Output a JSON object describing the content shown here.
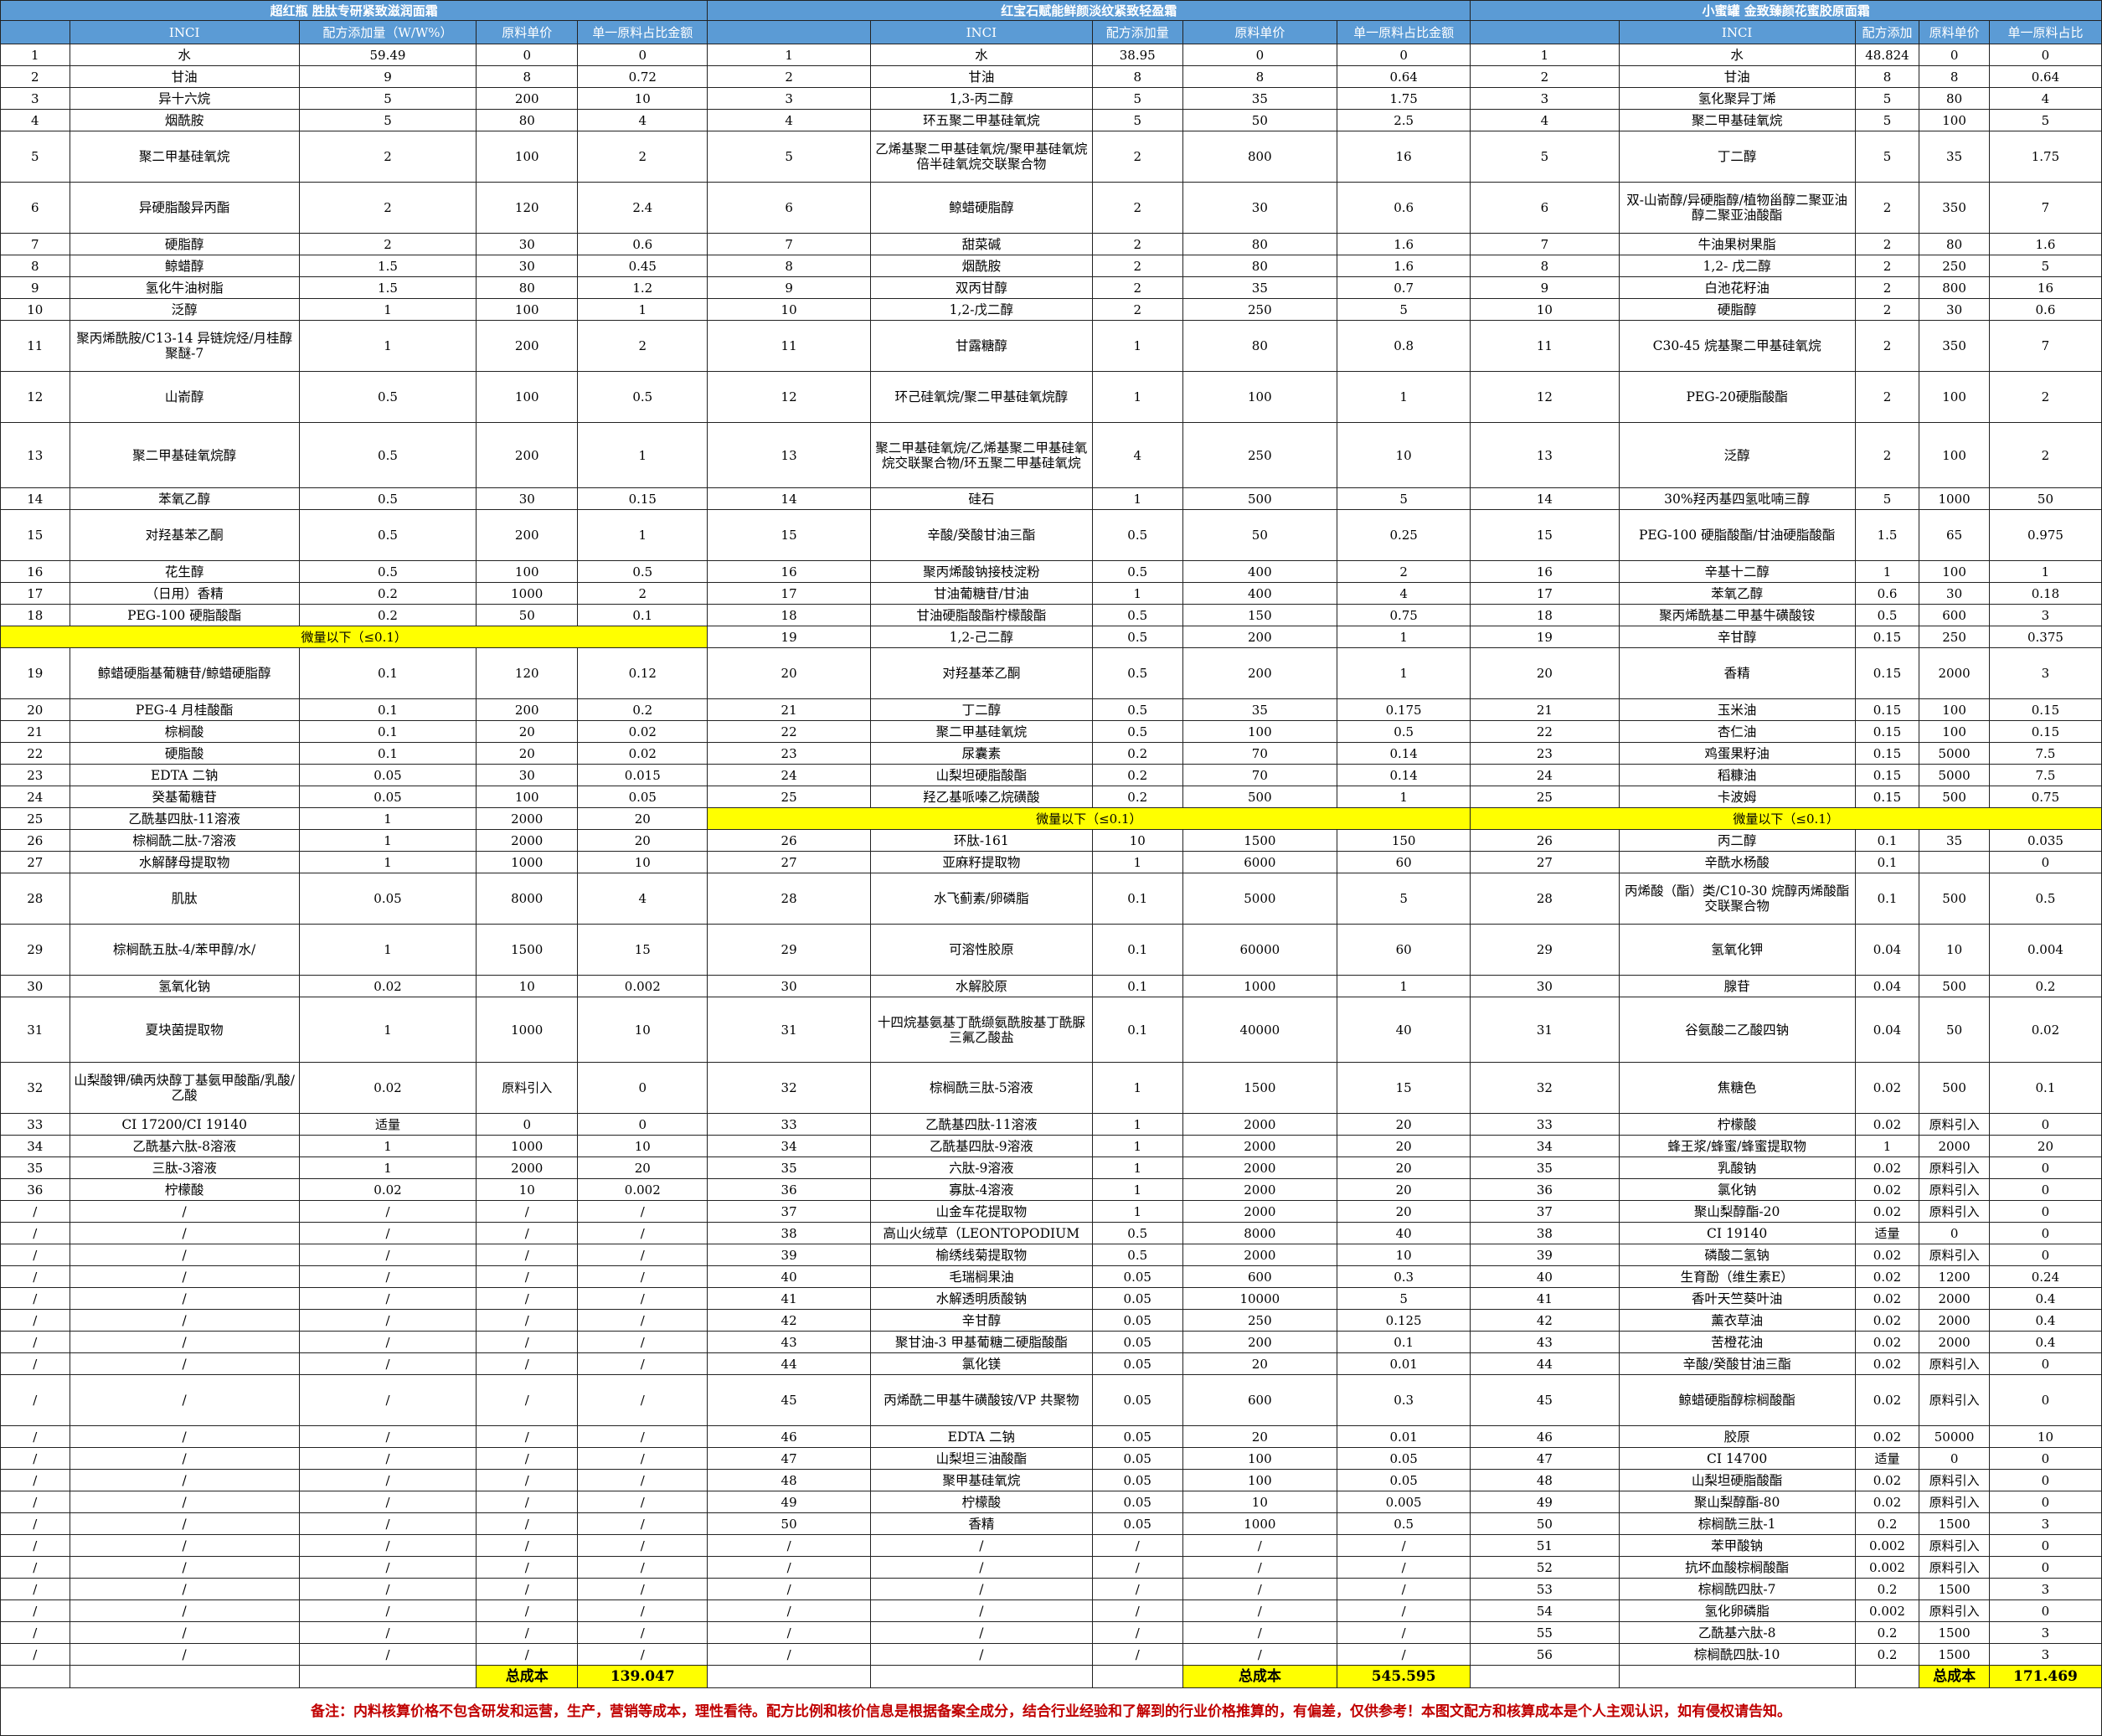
{
  "products": [
    {
      "title": "超红瓶 胜肽专研紧致滋润面霜"
    },
    {
      "title": "红宝石赋能鲜颜淡纹紧致轻盈霜"
    },
    {
      "title": "小蜜罐 金致臻颜花蜜胶原面霜"
    }
  ],
  "headers": [
    [
      "INCI",
      "配方添加量（W/W%）",
      "原料单价",
      "单一原料占比金额"
    ],
    [
      "INCI",
      "配方添加量",
      "原料单价",
      "单一原料占比金额"
    ],
    [
      "INCI",
      "配方添加",
      "原料单价",
      "单一原料占比"
    ]
  ],
  "trace_label": "微量以下（≤0.1）",
  "total_label": "总成本",
  "totals": [
    "139.047",
    "545.595",
    "171.469"
  ],
  "note": "备注：内料核算价格不包含研发和运营，生产，营销等成本，理性看待。配方比例和核价信息是根据备案全成分，结合行业经验和了解到的行业价格推算的，有偏差，仅供参考！本图文配方和核算成本是个人主观认识，如有侵权请告知。",
  "rows": [
    {
      "h": 1,
      "a": [
        "1",
        "水",
        "59.49",
        "0",
        "0"
      ],
      "b": [
        "1",
        "水",
        "38.95",
        "0",
        "0"
      ],
      "c": [
        "1",
        "水",
        "48.824",
        "0",
        "0"
      ]
    },
    {
      "h": 1,
      "a": [
        "2",
        "甘油",
        "9",
        "8",
        "0.72"
      ],
      "b": [
        "2",
        "甘油",
        "8",
        "8",
        "0.64"
      ],
      "c": [
        "2",
        "甘油",
        "8",
        "8",
        "0.64"
      ]
    },
    {
      "h": 1,
      "a": [
        "3",
        "异十六烷",
        "5",
        "200",
        "10"
      ],
      "b": [
        "3",
        "1,3-丙二醇",
        "5",
        "35",
        "1.75"
      ],
      "c": [
        "3",
        "氢化聚异丁烯",
        "5",
        "80",
        "4"
      ]
    },
    {
      "h": 1,
      "a": [
        "4",
        "烟酰胺",
        "5",
        "80",
        "4"
      ],
      "b": [
        "4",
        "环五聚二甲基硅氧烷",
        "5",
        "50",
        "2.5"
      ],
      "c": [
        "4",
        "聚二甲基硅氧烷",
        "5",
        "100",
        "5"
      ]
    },
    {
      "h": 2,
      "a": [
        "5",
        "聚二甲基硅氧烷",
        "2",
        "100",
        "2"
      ],
      "b": [
        "5",
        "乙烯基聚二甲基硅氧烷/聚甲基硅氧烷倍半硅氧烷交联聚合物",
        "2",
        "800",
        "16"
      ],
      "c": [
        "5",
        "丁二醇",
        "5",
        "35",
        "1.75"
      ]
    },
    {
      "h": 2,
      "a": [
        "6",
        "异硬脂酸异丙酯",
        "2",
        "120",
        "2.4"
      ],
      "b": [
        "6",
        "鲸蜡硬脂醇",
        "2",
        "30",
        "0.6"
      ],
      "c": [
        "6",
        "双-山嵛醇/异硬脂醇/植物甾醇二聚亚油醇二聚亚油酸酯",
        "2",
        "350",
        "7"
      ]
    },
    {
      "h": 1,
      "a": [
        "7",
        "硬脂醇",
        "2",
        "30",
        "0.6"
      ],
      "b": [
        "7",
        "甜菜碱",
        "2",
        "80",
        "1.6"
      ],
      "c": [
        "7",
        "牛油果树果脂",
        "2",
        "80",
        "1.6"
      ]
    },
    {
      "h": 1,
      "a": [
        "8",
        "鲸蜡醇",
        "1.5",
        "30",
        "0.45"
      ],
      "b": [
        "8",
        "烟酰胺",
        "2",
        "80",
        "1.6"
      ],
      "c": [
        "8",
        "1,2- 戊二醇",
        "2",
        "250",
        "5"
      ]
    },
    {
      "h": 1,
      "a": [
        "9",
        "氢化牛油树脂",
        "1.5",
        "80",
        "1.2"
      ],
      "b": [
        "9",
        "双丙甘醇",
        "2",
        "35",
        "0.7"
      ],
      "c": [
        "9",
        "白池花籽油",
        "2",
        "800",
        "16"
      ]
    },
    {
      "h": 1,
      "a": [
        "10",
        "泛醇",
        "1",
        "100",
        "1"
      ],
      "b": [
        "10",
        "1,2-戊二醇",
        "2",
        "250",
        "5"
      ],
      "c": [
        "10",
        "硬脂醇",
        "2",
        "30",
        "0.6"
      ]
    },
    {
      "h": 2,
      "a": [
        "11",
        "聚丙烯酰胺/C13-14 异链烷烃/月桂醇聚醚-7",
        "1",
        "200",
        "2"
      ],
      "b": [
        "11",
        "甘露糖醇",
        "1",
        "80",
        "0.8"
      ],
      "c": [
        "11",
        "C30-45 烷基聚二甲基硅氧烷",
        "2",
        "350",
        "7"
      ]
    },
    {
      "h": 2,
      "a": [
        "12",
        "山嵛醇",
        "0.5",
        "100",
        "0.5"
      ],
      "b": [
        "12",
        "环己硅氧烷/聚二甲基硅氧烷醇",
        "1",
        "100",
        "1"
      ],
      "c": [
        "12",
        "PEG-20硬脂酸酯",
        "2",
        "100",
        "2"
      ]
    },
    {
      "h": 3,
      "a": [
        "13",
        "聚二甲基硅氧烷醇",
        "0.5",
        "200",
        "1"
      ],
      "b": [
        "13",
        "聚二甲基硅氧烷/乙烯基聚二甲基硅氧烷交联聚合物/环五聚二甲基硅氧烷",
        "4",
        "250",
        "10"
      ],
      "c": [
        "13",
        "泛醇",
        "2",
        "100",
        "2"
      ]
    },
    {
      "h": 1,
      "a": [
        "14",
        "苯氧乙醇",
        "0.5",
        "30",
        "0.15"
      ],
      "b": [
        "14",
        "硅石",
        "1",
        "500",
        "5"
      ],
      "c": [
        "14",
        "30%羟丙基四氢吡喃三醇",
        "5",
        "1000",
        "50"
      ]
    },
    {
      "h": 2,
      "a": [
        "15",
        "对羟基苯乙酮",
        "0.5",
        "200",
        "1"
      ],
      "b": [
        "15",
        "辛酸/癸酸甘油三酯",
        "0.5",
        "50",
        "0.25"
      ],
      "c": [
        "15",
        "PEG-100 硬脂酸酯/甘油硬脂酸酯",
        "1.5",
        "65",
        "0.975"
      ]
    },
    {
      "h": 1,
      "a": [
        "16",
        "花生醇",
        "0.5",
        "100",
        "0.5"
      ],
      "b": [
        "16",
        "聚丙烯酸钠接枝淀粉",
        "0.5",
        "400",
        "2"
      ],
      "c": [
        "16",
        "辛基十二醇",
        "1",
        "100",
        "1"
      ]
    },
    {
      "h": 1,
      "a": [
        "17",
        "（日用）香精",
        "0.2",
        "1000",
        "2"
      ],
      "b": [
        "17",
        "甘油葡糖苷/甘油",
        "1",
        "400",
        "4"
      ],
      "c": [
        "17",
        "苯氧乙醇",
        "0.6",
        "30",
        "0.18"
      ]
    },
    {
      "h": 1,
      "a": [
        "18",
        "PEG-100 硬脂酸酯",
        "0.2",
        "50",
        "0.1"
      ],
      "b": [
        "18",
        "甘油硬脂酸酯柠檬酸酯",
        "0.5",
        "150",
        "0.75"
      ],
      "c": [
        "18",
        "聚丙烯酰基二甲基牛磺酸铵",
        "0.5",
        "600",
        "3"
      ]
    },
    {
      "h": 1,
      "a": "trace",
      "b": [
        "19",
        "1,2-己二醇",
        "0.5",
        "200",
        "1"
      ],
      "c": [
        "19",
        "辛甘醇",
        "0.15",
        "250",
        "0.375"
      ]
    },
    {
      "h": 2,
      "a": [
        "19",
        "鲸蜡硬脂基葡糖苷/鲸蜡硬脂醇",
        "0.1",
        "120",
        "0.12"
      ],
      "b": [
        "20",
        "对羟基苯乙酮",
        "0.5",
        "200",
        "1"
      ],
      "c": [
        "20",
        "香精",
        "0.15",
        "2000",
        "3"
      ]
    },
    {
      "h": 1,
      "a": [
        "20",
        "PEG-4 月桂酸酯",
        "0.1",
        "200",
        "0.2"
      ],
      "b": [
        "21",
        "丁二醇",
        "0.5",
        "35",
        "0.175"
      ],
      "c": [
        "21",
        "玉米油",
        "0.15",
        "100",
        "0.15"
      ]
    },
    {
      "h": 1,
      "a": [
        "21",
        "棕榈酸",
        "0.1",
        "20",
        "0.02"
      ],
      "b": [
        "22",
        "聚二甲基硅氧烷",
        "0.5",
        "100",
        "0.5"
      ],
      "c": [
        "22",
        "杏仁油",
        "0.15",
        "100",
        "0.15"
      ]
    },
    {
      "h": 1,
      "a": [
        "22",
        "硬脂酸",
        "0.1",
        "20",
        "0.02"
      ],
      "b": [
        "23",
        "尿囊素",
        "0.2",
        "70",
        "0.14"
      ],
      "c": [
        "23",
        "鸡蛋果籽油",
        "0.15",
        "5000",
        "7.5"
      ]
    },
    {
      "h": 1,
      "a": [
        "23",
        "EDTA 二钠",
        "0.05",
        "30",
        "0.015"
      ],
      "b": [
        "24",
        "山梨坦硬脂酸酯",
        "0.2",
        "70",
        "0.14"
      ],
      "c": [
        "24",
        "稻糠油",
        "0.15",
        "5000",
        "7.5"
      ]
    },
    {
      "h": 1,
      "a": [
        "24",
        "癸基葡糖苷",
        "0.05",
        "100",
        "0.05"
      ],
      "b": [
        "25",
        "羟乙基哌嗪乙烷磺酸",
        "0.2",
        "500",
        "1"
      ],
      "c": [
        "25",
        "卡波姆",
        "0.15",
        "500",
        "0.75"
      ]
    },
    {
      "h": 1,
      "a": [
        "25",
        "乙酰基四肽-11溶液",
        "1",
        "2000",
        "20"
      ],
      "b": "trace",
      "c": "trace"
    },
    {
      "h": 1,
      "a": [
        "26",
        "棕榈酰二肽-7溶液",
        "1",
        "2000",
        "20"
      ],
      "b": [
        "26",
        "环肽-161",
        "10",
        "1500",
        "150"
      ],
      "c": [
        "26",
        "丙二醇",
        "0.1",
        "35",
        "0.035"
      ]
    },
    {
      "h": 1,
      "a": [
        "27",
        "水解酵母提取物",
        "1",
        "1000",
        "10"
      ],
      "b": [
        "27",
        "亚麻籽提取物",
        "1",
        "6000",
        "60"
      ],
      "c": [
        "27",
        "辛酰水杨酸",
        "0.1",
        "",
        "0"
      ]
    },
    {
      "h": 2,
      "a": [
        "28",
        "肌肽",
        "0.05",
        "8000",
        "4"
      ],
      "b": [
        "28",
        "水飞蓟素/卵磷脂",
        "0.1",
        "5000",
        "5"
      ],
      "c": [
        "28",
        "丙烯酸（酯）类/C10-30 烷醇丙烯酸酯交联聚合物",
        "0.1",
        "500",
        "0.5"
      ]
    },
    {
      "h": 2,
      "a": [
        "29",
        "棕榈酰五肽-4/苯甲醇/水/",
        "1",
        "1500",
        "15"
      ],
      "b": [
        "29",
        "可溶性胶原",
        "0.1",
        "60000",
        "60"
      ],
      "c": [
        "29",
        "氢氧化钾",
        "0.04",
        "10",
        "0.004"
      ]
    },
    {
      "h": 1,
      "a": [
        "30",
        "氢氧化钠",
        "0.02",
        "10",
        "0.002"
      ],
      "b": [
        "30",
        "水解胶原",
        "0.1",
        "1000",
        "1"
      ],
      "c": [
        "30",
        "腺苷",
        "0.04",
        "500",
        "0.2"
      ]
    },
    {
      "h": 3,
      "a": [
        "31",
        "夏块菌提取物",
        "1",
        "1000",
        "10"
      ],
      "b": [
        "31",
        "十四烷基氨基丁酰缬氨酰胺基丁酰脲三氟乙酸盐",
        "0.1",
        "40000",
        "40"
      ],
      "c": [
        "31",
        "谷氨酸二乙酸四钠",
        "0.04",
        "50",
        "0.02"
      ]
    },
    {
      "h": 2,
      "a": [
        "32",
        "山梨酸钾/碘丙炔醇丁基氨甲酸酯/乳酸/乙酸",
        "0.02",
        "原料引入",
        "0"
      ],
      "b": [
        "32",
        "棕榈酰三肽-5溶液",
        "1",
        "1500",
        "15"
      ],
      "c": [
        "32",
        "焦糖色",
        "0.02",
        "500",
        "0.1"
      ]
    },
    {
      "h": 1,
      "a": [
        "33",
        "CI 17200/CI 19140",
        "适量",
        "0",
        "0"
      ],
      "b": [
        "33",
        "乙酰基四肽-11溶液",
        "1",
        "2000",
        "20"
      ],
      "c": [
        "33",
        "柠檬酸",
        "0.02",
        "原料引入",
        "0"
      ]
    },
    {
      "h": 1,
      "a": [
        "34",
        "乙酰基六肽-8溶液",
        "1",
        "1000",
        "10"
      ],
      "b": [
        "34",
        "乙酰基四肽-9溶液",
        "1",
        "2000",
        "20"
      ],
      "c": [
        "34",
        "蜂王浆/蜂蜜/蜂蜜提取物",
        "1",
        "2000",
        "20"
      ]
    },
    {
      "h": 1,
      "a": [
        "35",
        "三肽-3溶液",
        "1",
        "2000",
        "20"
      ],
      "b": [
        "35",
        "六肽-9溶液",
        "1",
        "2000",
        "20"
      ],
      "c": [
        "35",
        "乳酸钠",
        "0.02",
        "原料引入",
        "0"
      ]
    },
    {
      "h": 1,
      "a": [
        "36",
        "柠檬酸",
        "0.02",
        "10",
        "0.002"
      ],
      "b": [
        "36",
        "寡肽-4溶液",
        "1",
        "2000",
        "20"
      ],
      "c": [
        "36",
        "氯化钠",
        "0.02",
        "原料引入",
        "0"
      ]
    },
    {
      "h": 1,
      "a": [
        "/",
        "/",
        "/",
        "/",
        "/"
      ],
      "b": [
        "37",
        "山金车花提取物",
        "1",
        "2000",
        "20"
      ],
      "c": [
        "37",
        "聚山梨醇酯-20",
        "0.02",
        "原料引入",
        "0"
      ]
    },
    {
      "h": 1,
      "a": [
        "/",
        "/",
        "/",
        "/",
        "/"
      ],
      "b": [
        "38",
        "高山火绒草（LEONTOPODIUM",
        "0.5",
        "8000",
        "40"
      ],
      "c": [
        "38",
        "CI 19140",
        "适量",
        "0",
        "0"
      ]
    },
    {
      "h": 1,
      "a": [
        "/",
        "/",
        "/",
        "/",
        "/"
      ],
      "b": [
        "39",
        "榆绣线菊提取物",
        "0.5",
        "2000",
        "10"
      ],
      "c": [
        "39",
        "磷酸二氢钠",
        "0.02",
        "原料引入",
        "0"
      ]
    },
    {
      "h": 1,
      "a": [
        "/",
        "/",
        "/",
        "/",
        "/"
      ],
      "b": [
        "40",
        "毛瑞榈果油",
        "0.05",
        "600",
        "0.3"
      ],
      "c": [
        "40",
        "生育酚（维生素E）",
        "0.02",
        "1200",
        "0.24"
      ]
    },
    {
      "h": 1,
      "a": [
        "/",
        "/",
        "/",
        "/",
        "/"
      ],
      "b": [
        "41",
        "水解透明质酸钠",
        "0.05",
        "10000",
        "5"
      ],
      "c": [
        "41",
        "香叶天竺葵叶油",
        "0.02",
        "2000",
        "0.4"
      ]
    },
    {
      "h": 1,
      "a": [
        "/",
        "/",
        "/",
        "/",
        "/"
      ],
      "b": [
        "42",
        "辛甘醇",
        "0.05",
        "250",
        "0.125"
      ],
      "c": [
        "42",
        "薰衣草油",
        "0.02",
        "2000",
        "0.4"
      ]
    },
    {
      "h": 1,
      "a": [
        "/",
        "/",
        "/",
        "/",
        "/"
      ],
      "b": [
        "43",
        "聚甘油-3 甲基葡糖二硬脂酸酯",
        "0.05",
        "200",
        "0.1"
      ],
      "c": [
        "43",
        "苦橙花油",
        "0.02",
        "2000",
        "0.4"
      ]
    },
    {
      "h": 1,
      "a": [
        "/",
        "/",
        "/",
        "/",
        "/"
      ],
      "b": [
        "44",
        "氯化镁",
        "0.05",
        "20",
        "0.01"
      ],
      "c": [
        "44",
        "辛酸/癸酸甘油三酯",
        "0.02",
        "原料引入",
        "0"
      ]
    },
    {
      "h": 2,
      "a": [
        "/",
        "/",
        "/",
        "/",
        "/"
      ],
      "b": [
        "45",
        "丙烯酰二甲基牛磺酸铵/VP 共聚物",
        "0.05",
        "600",
        "0.3"
      ],
      "c": [
        "45",
        "鲸蜡硬脂醇棕榈酸酯",
        "0.02",
        "原料引入",
        "0"
      ]
    },
    {
      "h": 1,
      "a": [
        "/",
        "/",
        "/",
        "/",
        "/"
      ],
      "b": [
        "46",
        "EDTA 二钠",
        "0.05",
        "20",
        "0.01"
      ],
      "c": [
        "46",
        "胶原",
        "0.02",
        "50000",
        "10"
      ]
    },
    {
      "h": 1,
      "a": [
        "/",
        "/",
        "/",
        "/",
        "/"
      ],
      "b": [
        "47",
        "山梨坦三油酸酯",
        "0.05",
        "100",
        "0.05"
      ],
      "c": [
        "47",
        "CI 14700",
        "适量",
        "0",
        "0"
      ]
    },
    {
      "h": 1,
      "a": [
        "/",
        "/",
        "/",
        "/",
        "/"
      ],
      "b": [
        "48",
        "聚甲基硅氧烷",
        "0.05",
        "100",
        "0.05"
      ],
      "c": [
        "48",
        "山梨坦硬脂酸酯",
        "0.02",
        "原料引入",
        "0"
      ]
    },
    {
      "h": 1,
      "a": [
        "/",
        "/",
        "/",
        "/",
        "/"
      ],
      "b": [
        "49",
        "柠檬酸",
        "0.05",
        "10",
        "0.005"
      ],
      "c": [
        "49",
        "聚山梨醇酯-80",
        "0.02",
        "原料引入",
        "0"
      ]
    },
    {
      "h": 1,
      "a": [
        "/",
        "/",
        "/",
        "/",
        "/"
      ],
      "b": [
        "50",
        "香精",
        "0.05",
        "1000",
        "0.5"
      ],
      "c": [
        "50",
        "棕榈酰三肽-1",
        "0.2",
        "1500",
        "3"
      ]
    },
    {
      "h": 1,
      "a": [
        "/",
        "/",
        "/",
        "/",
        "/"
      ],
      "b": [
        "/",
        "/",
        "/",
        "/",
        "/"
      ],
      "c": [
        "51",
        "苯甲酸钠",
        "0.002",
        "原料引入",
        "0"
      ]
    },
    {
      "h": 1,
      "a": [
        "/",
        "/",
        "/",
        "/",
        "/"
      ],
      "b": [
        "/",
        "/",
        "/",
        "/",
        "/"
      ],
      "c": [
        "52",
        "抗坏血酸棕榈酸酯",
        "0.002",
        "原料引入",
        "0"
      ]
    },
    {
      "h": 1,
      "a": [
        "/",
        "/",
        "/",
        "/",
        "/"
      ],
      "b": [
        "/",
        "/",
        "/",
        "/",
        "/"
      ],
      "c": [
        "53",
        "棕榈酰四肽-7",
        "0.2",
        "1500",
        "3"
      ]
    },
    {
      "h": 1,
      "a": [
        "/",
        "/",
        "/",
        "/",
        "/"
      ],
      "b": [
        "/",
        "/",
        "/",
        "/",
        "/"
      ],
      "c": [
        "54",
        "氢化卵磷脂",
        "0.002",
        "原料引入",
        "0"
      ]
    },
    {
      "h": 1,
      "a": [
        "/",
        "/",
        "/",
        "/",
        "/"
      ],
      "b": [
        "/",
        "/",
        "/",
        "/",
        "/"
      ],
      "c": [
        "55",
        "乙酰基六肽-8",
        "0.2",
        "1500",
        "3"
      ]
    },
    {
      "h": 1,
      "a": [
        "/",
        "/",
        "/",
        "/",
        "/"
      ],
      "b": [
        "/",
        "/",
        "/",
        "/",
        "/"
      ],
      "c": [
        "56",
        "棕榈酰四肽-10",
        "0.2",
        "1500",
        "3"
      ]
    }
  ]
}
